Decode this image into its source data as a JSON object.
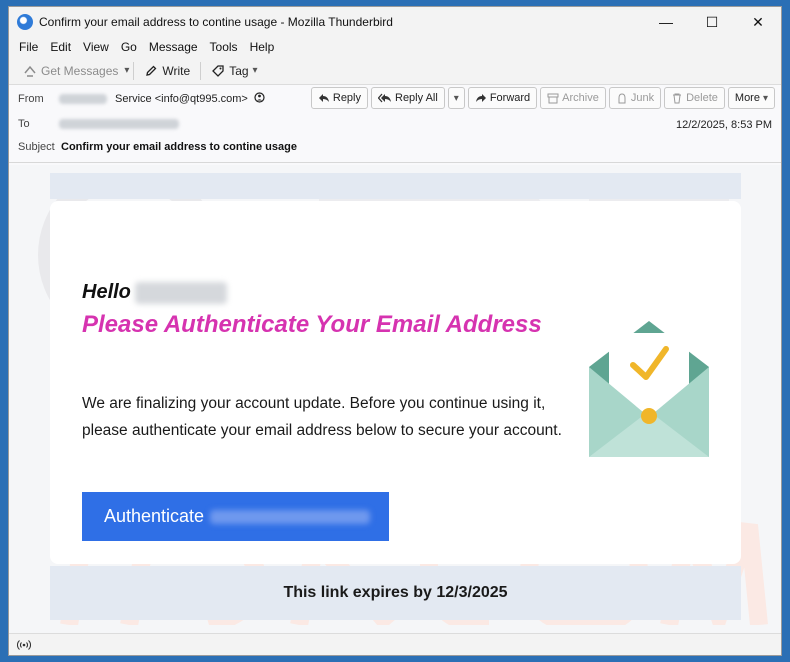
{
  "window": {
    "title": "Confirm your email address to contine usage - Mozilla Thunderbird",
    "minimize_glyph": "—",
    "maximize_glyph": "☐",
    "close_glyph": "✕"
  },
  "menu": [
    "File",
    "Edit",
    "View",
    "Go",
    "Message",
    "Tools",
    "Help"
  ],
  "toolbar": {
    "get_messages": "Get Messages",
    "write": "Write",
    "tag": "Tag"
  },
  "header": {
    "from_label": "From",
    "sender": "Service <info@qt995.com>",
    "to_label": "To",
    "subject_label": "Subject",
    "subject": "Confirm your email address to contine usage",
    "date": "12/2/2025, 8:53 PM",
    "buttons": {
      "reply": "Reply",
      "reply_all": "Reply All",
      "forward": "Forward",
      "archive": "Archive",
      "junk": "Junk",
      "delete": "Delete",
      "more": "More"
    }
  },
  "email": {
    "hello": "Hello",
    "headline": "Please Authenticate Your Email Address",
    "body": "We are finalizing your account update. Before you continue using it, please authenticate your email address below to secure your account.",
    "button_label": "Authenticate",
    "footer": "This link expires by 12/3/2025"
  },
  "colors": {
    "headline": "#d633b0",
    "button": "#2f6fe6",
    "envelope": "#6fb3a0",
    "check": "#f0b62a"
  },
  "icons": {
    "status": "wifi-icon",
    "shield": "shield-icon"
  }
}
